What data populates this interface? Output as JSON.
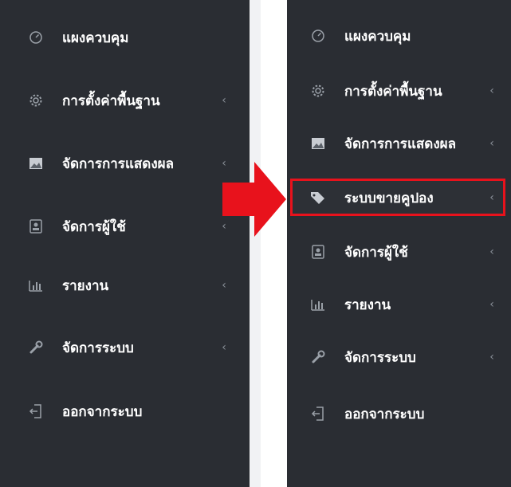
{
  "colors": {
    "sidebar_bg": "#2a2d33",
    "text": "#ffffff",
    "icon": "#9aa0a8",
    "highlight": "#e8121c",
    "arrow": "#e8121c"
  },
  "left_menu": {
    "items": [
      {
        "icon": "speedometer-icon",
        "label": "แผงควบคุม",
        "has_chevron": false
      },
      {
        "icon": "gear-icon",
        "label": "การตั้งค่าพื้นฐาน",
        "has_chevron": true,
        "chevron": "‹"
      },
      {
        "icon": "image-icon",
        "label": "จัดการการแสดงผล",
        "has_chevron": true,
        "chevron": "‹"
      },
      {
        "icon": "contact-card-icon",
        "label": "จัดการผู้ใช้",
        "has_chevron": true,
        "chevron": "‹"
      },
      {
        "icon": "bar-chart-icon",
        "label": "รายงาน",
        "has_chevron": true,
        "chevron": "‹"
      },
      {
        "icon": "wrench-icon",
        "label": "จัดการระบบ",
        "has_chevron": true,
        "chevron": "‹"
      },
      {
        "icon": "logout-icon",
        "label": "ออกจากระบบ",
        "has_chevron": false
      }
    ]
  },
  "right_menu": {
    "items": [
      {
        "icon": "speedometer-icon",
        "label": "แผงควบคุม",
        "has_chevron": false
      },
      {
        "icon": "gear-icon",
        "label": "การตั้งค่าพื้นฐาน",
        "has_chevron": true,
        "chevron": "‹"
      },
      {
        "icon": "image-icon",
        "label": "จัดการการแสดงผล",
        "has_chevron": true,
        "chevron": "‹"
      },
      {
        "icon": "tag-icon",
        "label": "ระบบขายคูปอง",
        "has_chevron": true,
        "chevron": "‹",
        "highlighted": true
      },
      {
        "icon": "contact-card-icon",
        "label": "จัดการผู้ใช้",
        "has_chevron": true,
        "chevron": "‹"
      },
      {
        "icon": "bar-chart-icon",
        "label": "รายงาน",
        "has_chevron": true,
        "chevron": "‹"
      },
      {
        "icon": "wrench-icon",
        "label": "จัดการระบบ",
        "has_chevron": true,
        "chevron": "‹"
      },
      {
        "icon": "logout-icon",
        "label": "ออกจากระบบ",
        "has_chevron": false
      }
    ]
  }
}
